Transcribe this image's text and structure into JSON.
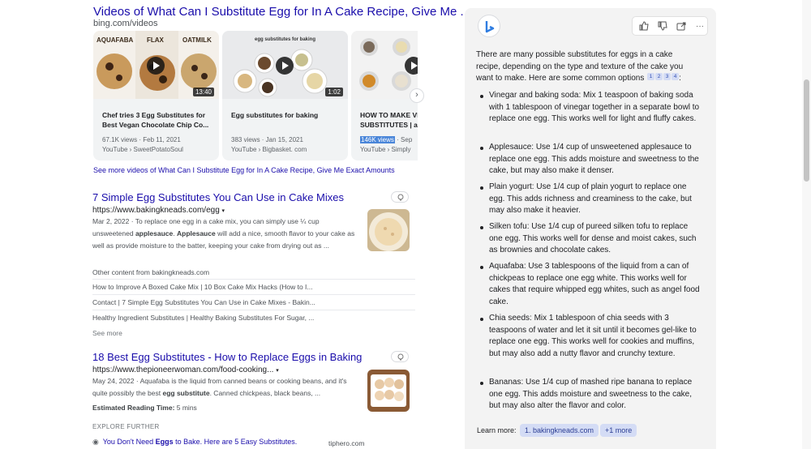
{
  "videos": {
    "title": "Videos of What Can I Substitute Egg for In A Cake Recipe, Give Me ...",
    "source": "bing.com/videos",
    "items": [
      {
        "thumb_labels": [
          "AQUAFABA",
          "FLAX",
          "OATMILK"
        ],
        "duration": "13:40",
        "title": "Chef tries 3 Egg Substitutes for Best Vegan Chocolate Chip Co...",
        "meta": "67.1K views · Feb 11, 2021",
        "source": "YouTube › SweetPotatoSoul"
      },
      {
        "thumb_labels": [
          "egg substitutes for baking"
        ],
        "duration": "1:02",
        "title": "Egg substitutes for baking",
        "meta": "383 views · Jan 15, 2021",
        "source": "YouTube › Bigbasket. com"
      },
      {
        "title": "HOW TO MAKE VE SUBSTITUTES | a",
        "meta_views": "146K views",
        "meta_rest": " · Sep",
        "source": "YouTube › Simply"
      }
    ],
    "next_icon": "chevron-right-icon",
    "see_more": "See more videos of What Can I Substitute Egg for In A Cake Recipe, Give Me Exact Amounts"
  },
  "results": [
    {
      "title": "7 Simple Egg Substitutes You Can Use in Cake Mixes",
      "url": "https://www.bakingkneads.com/egg",
      "snippet_pre": "Mar 2, 2022 · To replace one egg in a cake mix, you can simply use ¼ cup unsweetened ",
      "snippet_b1": "applesauce",
      "snippet_mid": ". ",
      "snippet_b2": "Applesauce",
      "snippet_post": " will add a nice, smooth flavor to your cake as well as provide moisture to the batter, keeping your cake from drying out as ...",
      "other_heading": "Other content from bakingkneads.com",
      "other_items": [
        "How to Improve A Boxed Cake Mix | 10 Box Cake Mix Hacks (How to I...",
        "Contact | 7 Simple Egg Substitutes You Can Use in Cake Mixes - Bakin...",
        "Healthy Ingredient Substitutes | Healthy Baking Substitutes For Sugar, ..."
      ],
      "see_more": "See more"
    },
    {
      "title": "18 Best Egg Substitutes - How to Replace Eggs in Baking",
      "url": "https://www.thepioneerwoman.com/food-cooking...",
      "snippet_pre": "May 24, 2022 · Aquafaba is the liquid from canned beans or cooking beans, and it's quite possibly the best ",
      "snippet_b1": "egg substitute",
      "snippet_post": ". Canned chickpeas, black beans, ...",
      "reading_label": "Estimated Reading Time:",
      "reading_value": " 5 mins"
    }
  ],
  "explore": {
    "heading": "EXPLORE FURTHER",
    "item_pre": "You Don't Need ",
    "item_bold": "Eggs",
    "item_post": " to Bake. Here are 5 Easy Substitutes.",
    "item_source": "tiphero.com"
  },
  "chat": {
    "intro": "There are many possible substitutes for eggs in a cake recipe, depending on the type and texture of the cake you want to make. Here are some common options",
    "citations": [
      "1",
      "2",
      "3",
      "4"
    ],
    "intro_end": ":",
    "bullets": [
      "Vinegar and baking soda: Mix 1 teaspoon of baking soda with 1 tablespoon of vinegar together in a separate bowl to replace one egg. This works well for light and fluffy cakes.",
      "Applesauce: Use 1/4 cup of unsweetened applesauce to replace one egg. This adds moisture and sweetness to the cake, but may also make it denser.",
      "Plain yogurt: Use 1/4 cup of plain yogurt to replace one egg. This adds richness and creaminess to the cake, but may also make it heavier.",
      "Silken tofu: Use 1/4 cup of pureed silken tofu to replace one egg. This works well for dense and moist cakes, such as brownies and chocolate cakes.",
      "Aquafaba: Use 3 tablespoons of the liquid from a can of chickpeas to replace one egg white. This works well for cakes that require whipped egg whites, such as angel food cake.",
      "Chia seeds: Mix 1 tablespoon of chia seeds with 3 teaspoons of water and let it sit until it becomes gel-like to replace one egg. This works well for cookies and muffins, but may also add a nutty flavor and crunchy texture.",
      "Bananas: Use 1/4 cup of mashed ripe banana to replace one egg. This adds moisture and sweetness to the cake, but may also alter the flavor and color."
    ],
    "learn_more_label": "Learn more:",
    "learn_more_chips": [
      "1. bakingkneads.com",
      "+1 more"
    ],
    "toolbar_icons": [
      "thumbs-up-icon",
      "thumbs-down-icon",
      "share-icon",
      "more-icon"
    ],
    "logo_icon": "bing-b-icon"
  },
  "colors": {
    "link": "#1a0dab",
    "accent_chip": "#d4dcf5",
    "panel_bg": "#f3f3f3"
  }
}
